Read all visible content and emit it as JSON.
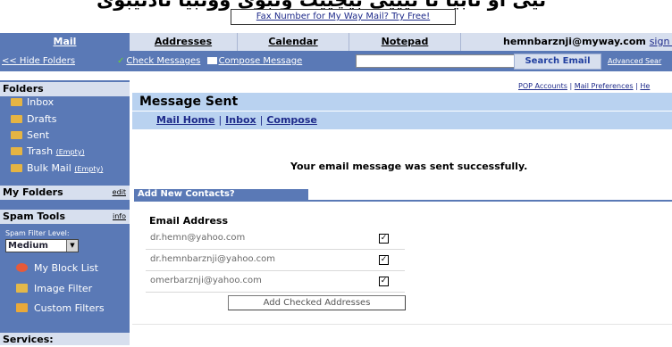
{
  "banner": {
    "arabic_text": "تیی او ئابیا ئا ئیییی بیچییت وئبوی ووئبیا ئادئیبوی",
    "fax_link": "Fax Number for My Way Mail? Try Free!"
  },
  "nav": {
    "tabs": [
      {
        "label": "Mail",
        "active": true
      },
      {
        "label": "Addresses"
      },
      {
        "label": "Calendar"
      },
      {
        "label": "Notepad"
      }
    ],
    "user_email": "hemnbarznji@myway.com",
    "sign_out": "sign o"
  },
  "toolbar": {
    "hide_folders": "<< Hide Folders",
    "check_messages": "Check Messages",
    "compose_message": "Compose Message",
    "search_value": "",
    "search_button": "Search Email",
    "advanced_search": "Advanced Sear"
  },
  "sidebar": {
    "folders_title": "Folders",
    "folders": [
      {
        "label": "Inbox",
        "icon": "inbox-icon"
      },
      {
        "label": "Drafts",
        "icon": "drafts-icon"
      },
      {
        "label": "Sent",
        "icon": "sent-icon"
      },
      {
        "label": "Trash",
        "icon": "trash-icon",
        "empty": "(Empty)"
      },
      {
        "label": "Bulk Mail",
        "icon": "bulk-mail-icon",
        "empty": "(Empty)"
      }
    ],
    "my_folders_title": "My Folders",
    "my_folders_edit": "edit",
    "spam_title": "Spam Tools",
    "spam_info": "info",
    "spam_filter_label": "Spam Filter Level:",
    "spam_filter_value": "Medium",
    "spam_items": [
      {
        "label": "My Block List",
        "icon": "block-list-icon",
        "color": "#e65a3a"
      },
      {
        "label": "Image Filter",
        "icon": "image-filter-icon",
        "color": "#e3b84a"
      },
      {
        "label": "Custom Filters",
        "icon": "custom-filters-icon",
        "color": "#e9a93a"
      }
    ],
    "services_title": "Services:"
  },
  "main": {
    "top_links": {
      "pop": "POP Accounts",
      "prefs": "Mail Preferences",
      "help": "He"
    },
    "title": "Message Sent",
    "subnav": [
      "Mail Home",
      "Inbox",
      "Compose"
    ],
    "success_message": "Your email message was sent successfully.",
    "contacts_header": "Add New Contacts?",
    "email_header": "Email Address",
    "emails": [
      {
        "address": "dr.hemn@yahoo.com",
        "checked": "✓"
      },
      {
        "address": "dr.hemnbarznji@yahoo.com",
        "checked": "✓"
      },
      {
        "address": "omerbarznji@yahoo.com",
        "checked": "✓"
      }
    ],
    "add_button": "Add Checked Addresses"
  },
  "colors": {
    "nav_blue": "#5a79b6",
    "light_blue": "#d7dfee",
    "header_blue": "#b9d2f0",
    "link": "#1e2a8a"
  }
}
